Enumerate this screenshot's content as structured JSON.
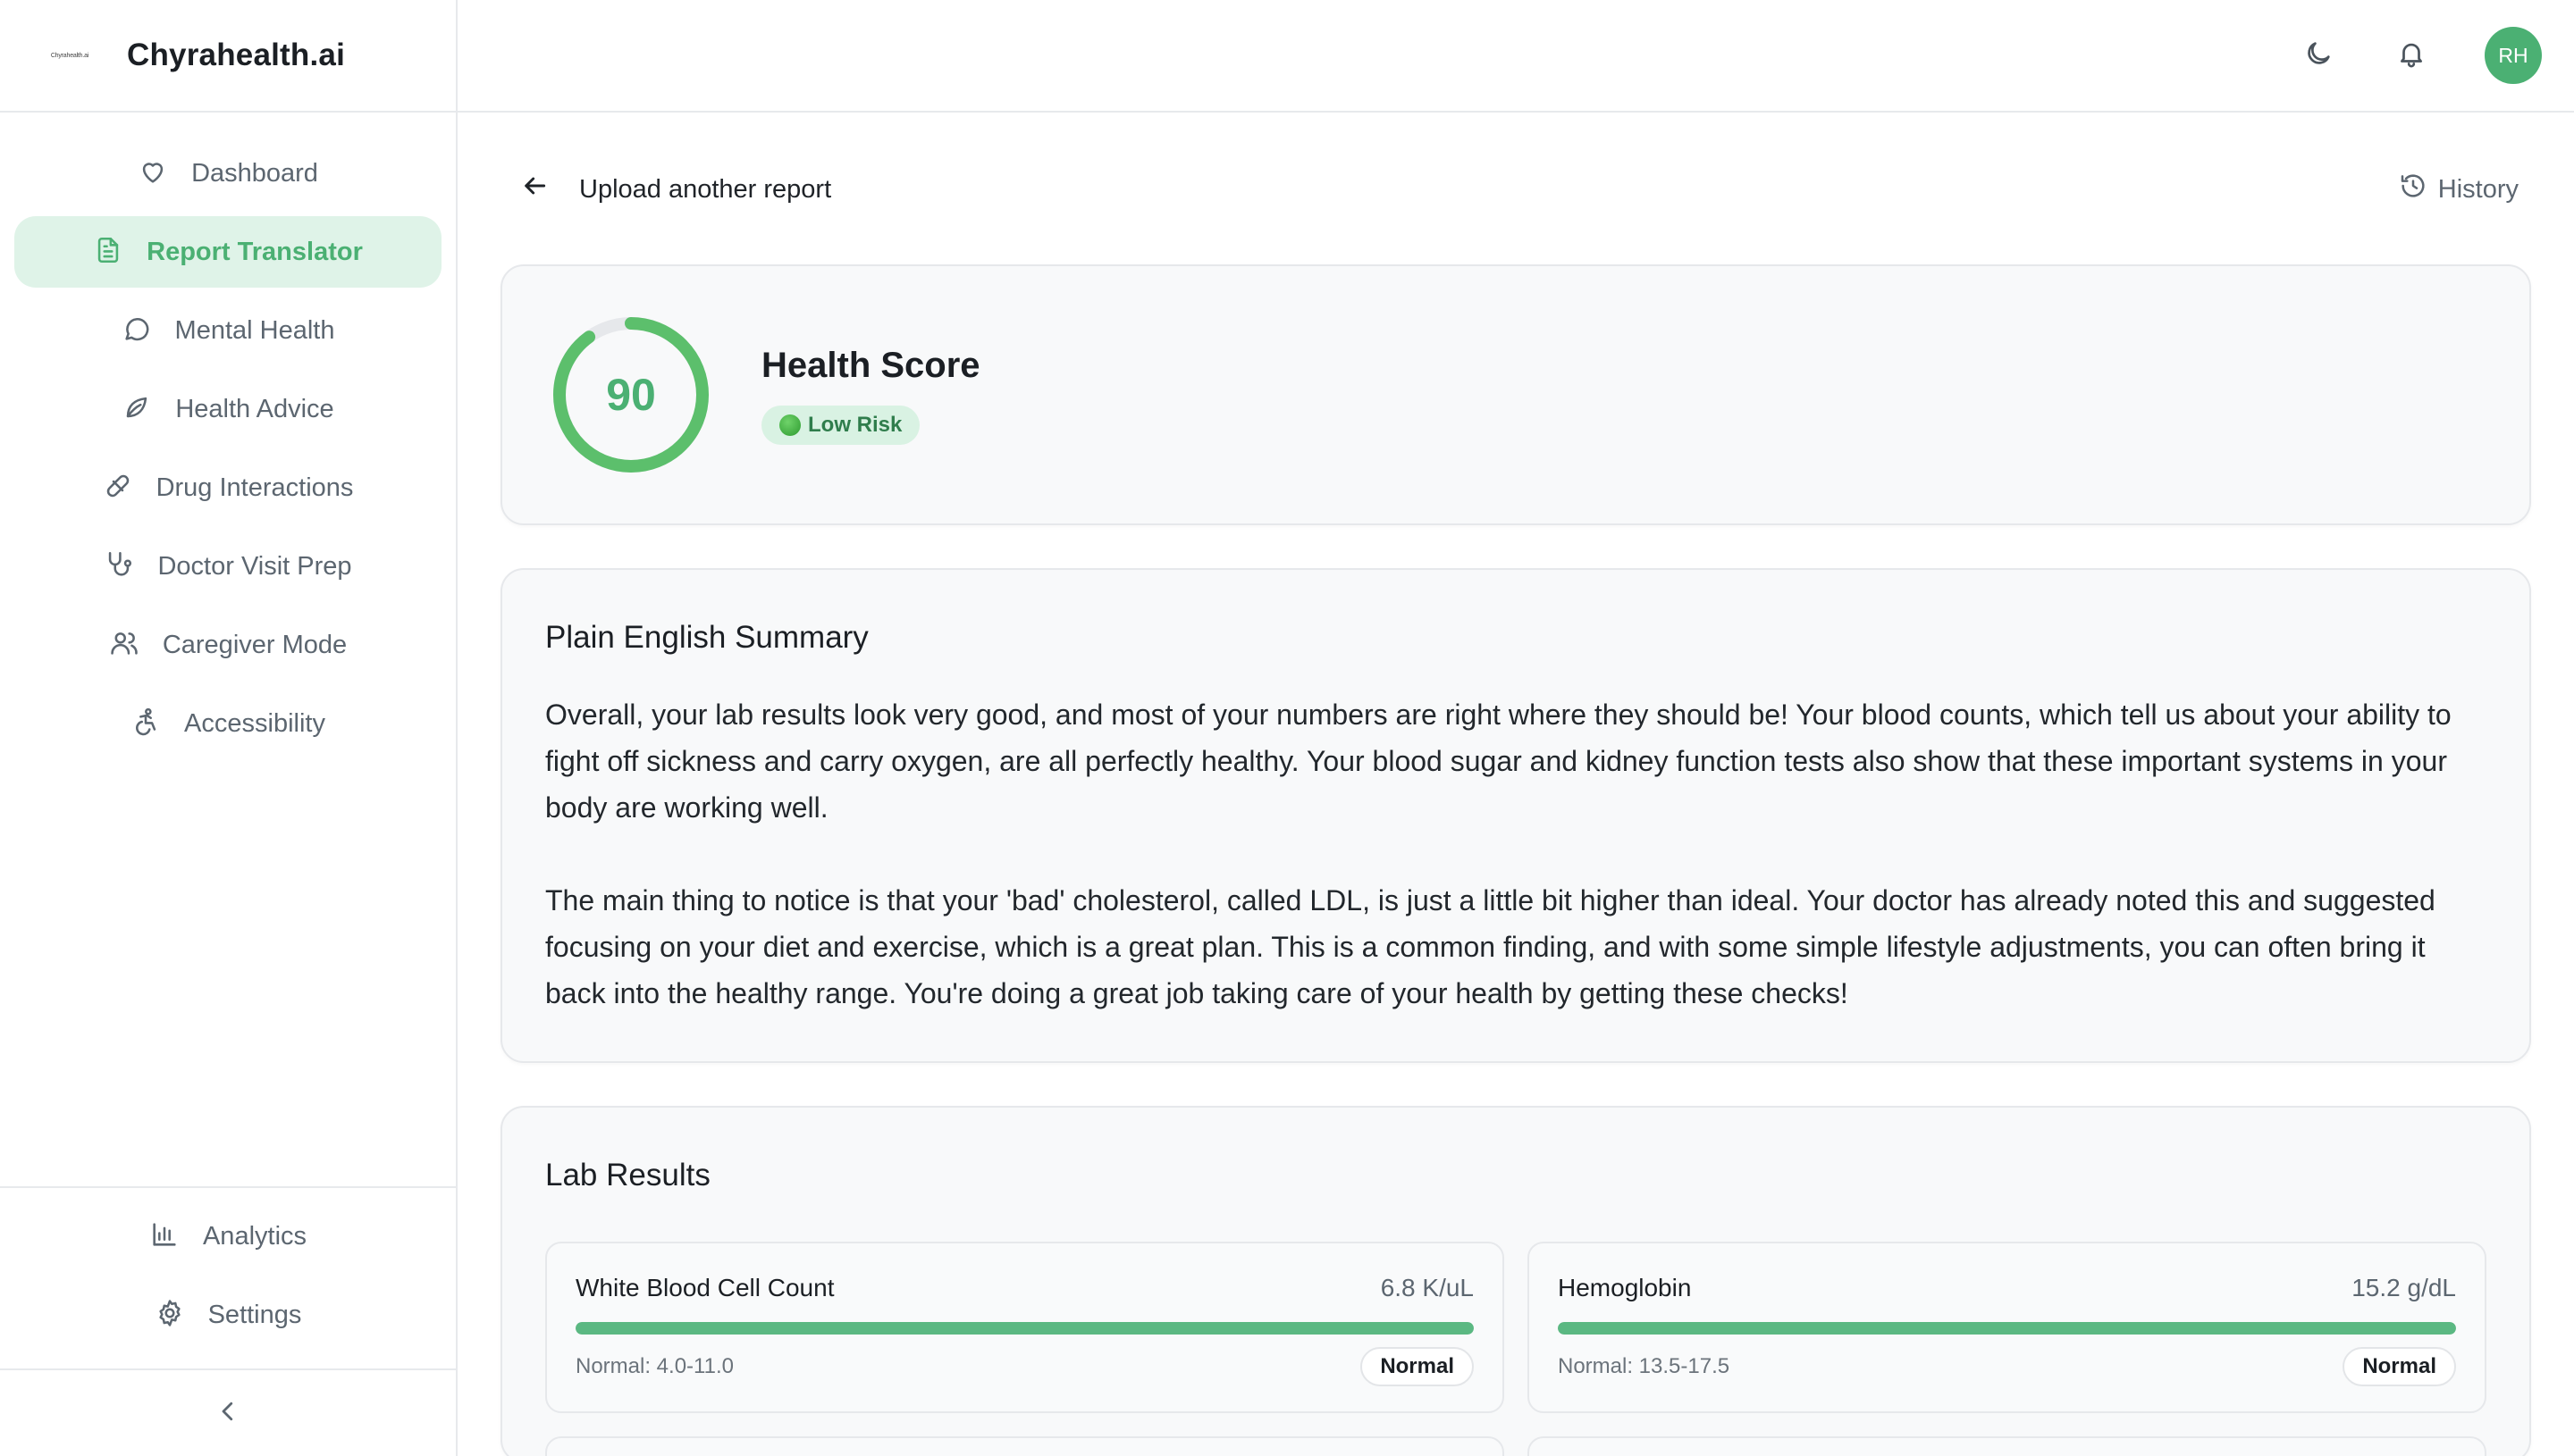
{
  "brand": {
    "logo_text": "Chyrahealth.ai",
    "name": "Chyrahealth.ai"
  },
  "sidebar": {
    "items": [
      {
        "label": "Dashboard",
        "icon": "heart-icon"
      },
      {
        "label": "Report Translator",
        "icon": "document-icon",
        "active": true
      },
      {
        "label": "Mental Health",
        "icon": "chat-bubble-icon"
      },
      {
        "label": "Health Advice",
        "icon": "leaf-icon"
      },
      {
        "label": "Drug Interactions",
        "icon": "pill-icon"
      },
      {
        "label": "Doctor Visit Prep",
        "icon": "stethoscope-icon"
      },
      {
        "label": "Caregiver Mode",
        "icon": "users-icon"
      },
      {
        "label": "Accessibility",
        "icon": "accessibility-icon"
      }
    ],
    "bottom_items": [
      {
        "label": "Analytics",
        "icon": "bar-chart-icon"
      },
      {
        "label": "Settings",
        "icon": "gear-icon"
      }
    ],
    "collapse_icon": "chevron-left-icon"
  },
  "topbar": {
    "theme_icon": "moon-icon",
    "notification_icon": "bell-icon",
    "avatar_initials": "RH"
  },
  "main": {
    "back_label": "Upload another report",
    "history_label": "History",
    "health_score": {
      "title": "Health Score",
      "score": "90",
      "score_fraction": 0.9,
      "risk_label": "Low Risk",
      "accent_color": "#4bb073"
    },
    "summary": {
      "title": "Plain English Summary",
      "paragraphs": [
        "Overall, your lab results look very good, and most of your numbers are right where they should be! Your blood counts, which tell us about your ability to fight off sickness and carry oxygen, are all perfectly healthy. Your blood sugar and kidney function tests also show that these important systems in your body are working well.",
        "The main thing to notice is that your 'bad' cholesterol, called LDL, is just a little bit higher than ideal. Your doctor has already noted this and suggested focusing on your diet and exercise, which is a great plan. This is a common finding, and with some simple lifestyle adjustments, you can often bring it back into the healthy range. You're doing a great job taking care of your health by getting these checks!"
      ]
    },
    "lab_results": {
      "title": "Lab Results",
      "items": [
        {
          "name": "White Blood Cell Count",
          "value": "6.8 K/uL",
          "range": "Normal: 4.0-11.0",
          "status": "Normal",
          "fill": 1.0
        },
        {
          "name": "Hemoglobin",
          "value": "15.2 g/dL",
          "range": "Normal: 13.5-17.5",
          "status": "Normal",
          "fill": 1.0
        }
      ]
    }
  }
}
